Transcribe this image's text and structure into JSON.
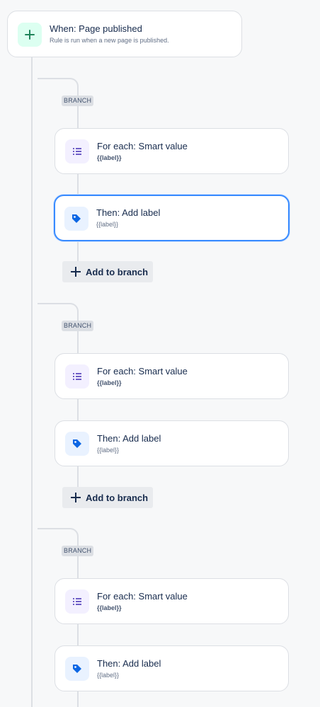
{
  "trigger": {
    "title": "When: Page published",
    "subtitle": "Rule is run when a new page is published.",
    "icon": "plus-icon"
  },
  "branches": [
    {
      "tag": "BRANCH",
      "for_each": {
        "title": "For each: Smart value",
        "value": "{{label}}",
        "icon": "list-icon"
      },
      "action": {
        "title": "Then: Add label",
        "value": "{{label}}",
        "icon": "tag-icon",
        "selected": true
      },
      "add_button": "Add to branch"
    },
    {
      "tag": "BRANCH",
      "for_each": {
        "title": "For each: Smart value",
        "value": "{{label}}",
        "icon": "list-icon"
      },
      "action": {
        "title": "Then: Add label",
        "value": "{{label}}",
        "icon": "tag-icon",
        "selected": false
      },
      "add_button": "Add to branch"
    },
    {
      "tag": "BRANCH",
      "for_each": {
        "title": "For each: Smart value",
        "value": "{{label}}",
        "icon": "list-icon"
      },
      "action": {
        "title": "Then: Add label",
        "value": "{{label}}",
        "icon": "tag-icon",
        "selected": false
      }
    }
  ],
  "colors": {
    "background": "#f7f8f9",
    "connector": "#dcdfe4",
    "selected_border": "#388bff",
    "trigger_icon": "#1f845a",
    "branch_icon": "#6e5dc6",
    "action_icon": "#0c66e4"
  }
}
